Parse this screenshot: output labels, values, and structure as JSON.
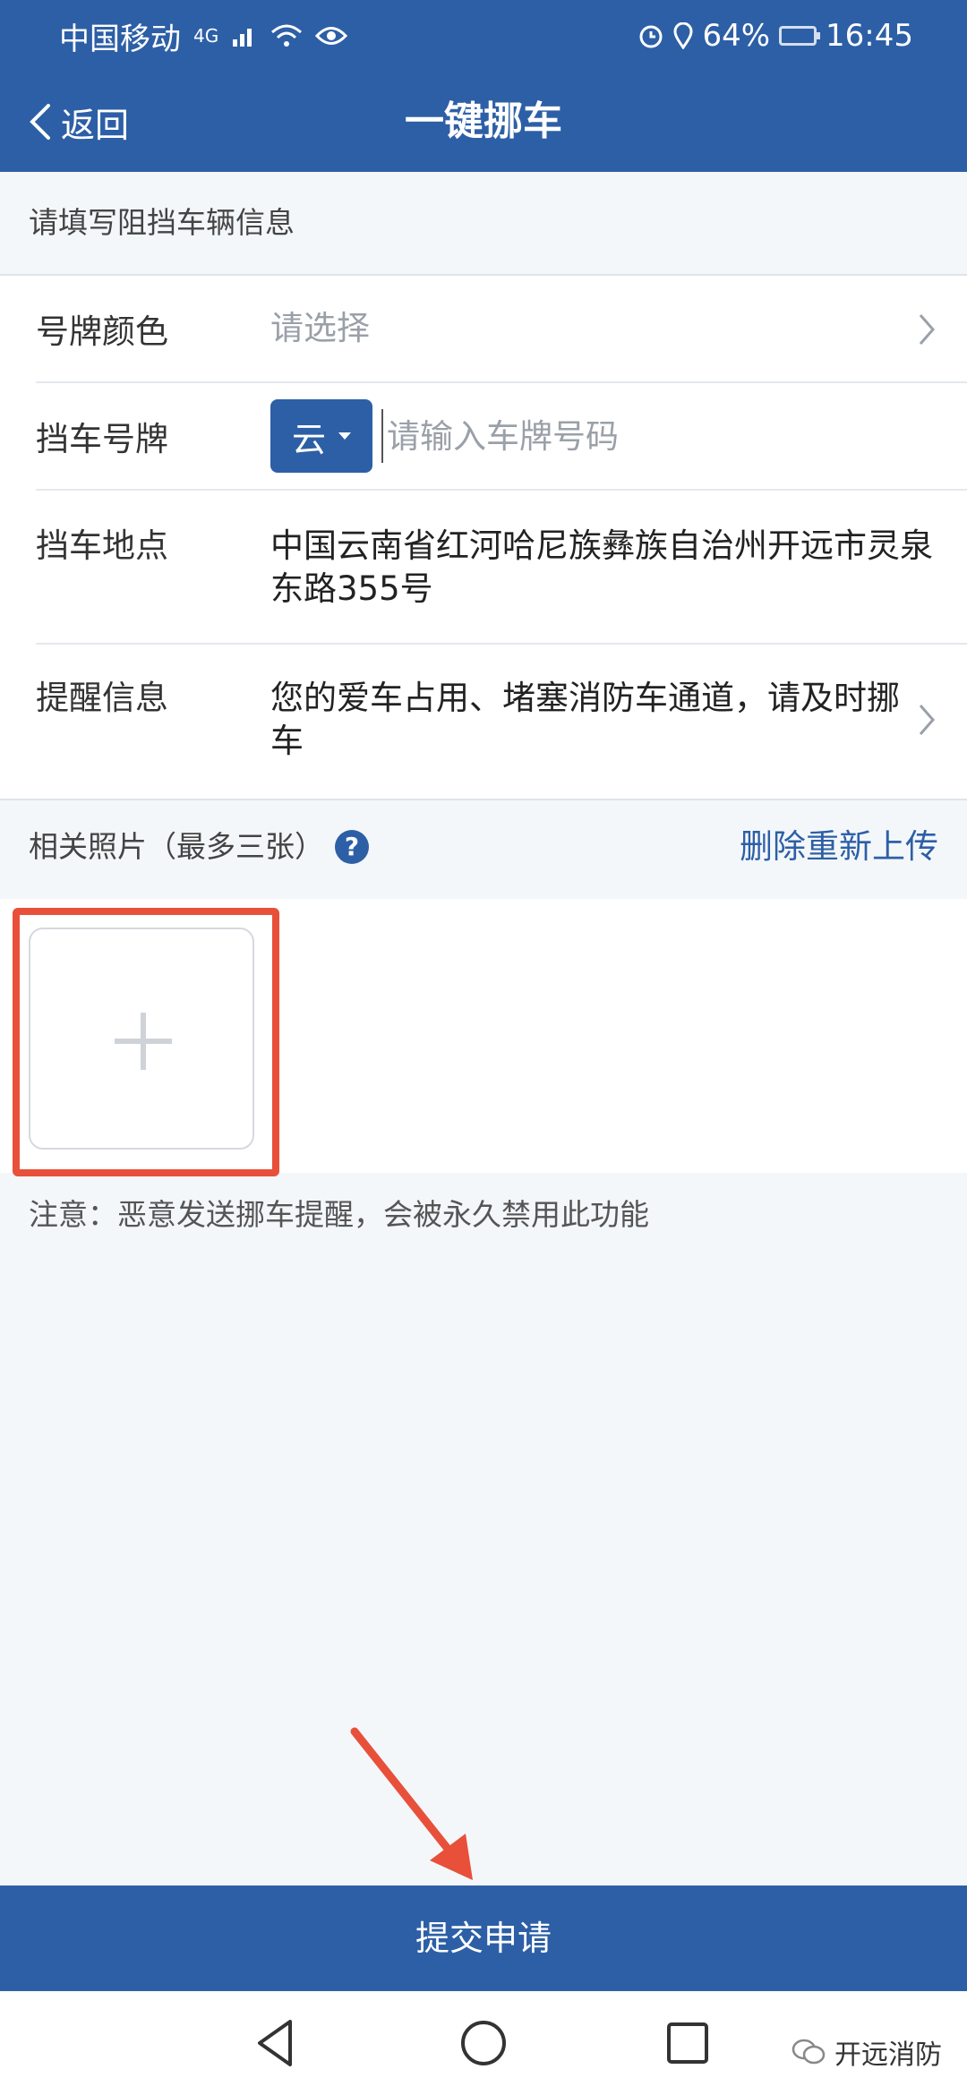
{
  "status_bar": {
    "carrier": "中国移动",
    "network": "4G",
    "battery": "64%",
    "time": "16:45"
  },
  "header": {
    "back_label": "返回",
    "title": "一键挪车"
  },
  "form_hint": "请填写阻挡车辆信息",
  "form": {
    "plate_color": {
      "label": "号牌颜色",
      "placeholder": "请选择"
    },
    "plate_number": {
      "label": "挡车号牌",
      "province": "云",
      "placeholder": "请输入车牌号码",
      "value": ""
    },
    "location": {
      "label": "挡车地点",
      "value": "中国云南省红河哈尼族彝族自治州开远市灵泉东路355号"
    },
    "reminder": {
      "label": "提醒信息",
      "value": "您的爱车占用、堵塞消防车通道，请及时挪车"
    }
  },
  "photos": {
    "label": "相关照片（最多三张）",
    "help_icon": "?",
    "reupload_label": "删除重新上传"
  },
  "notice": "注意：恶意发送挪车提醒，会被永久禁用此功能",
  "submit_label": "提交申请",
  "watermark": "开远消防",
  "colors": {
    "primary": "#2d5fa6",
    "annotation": "#e8503a"
  }
}
